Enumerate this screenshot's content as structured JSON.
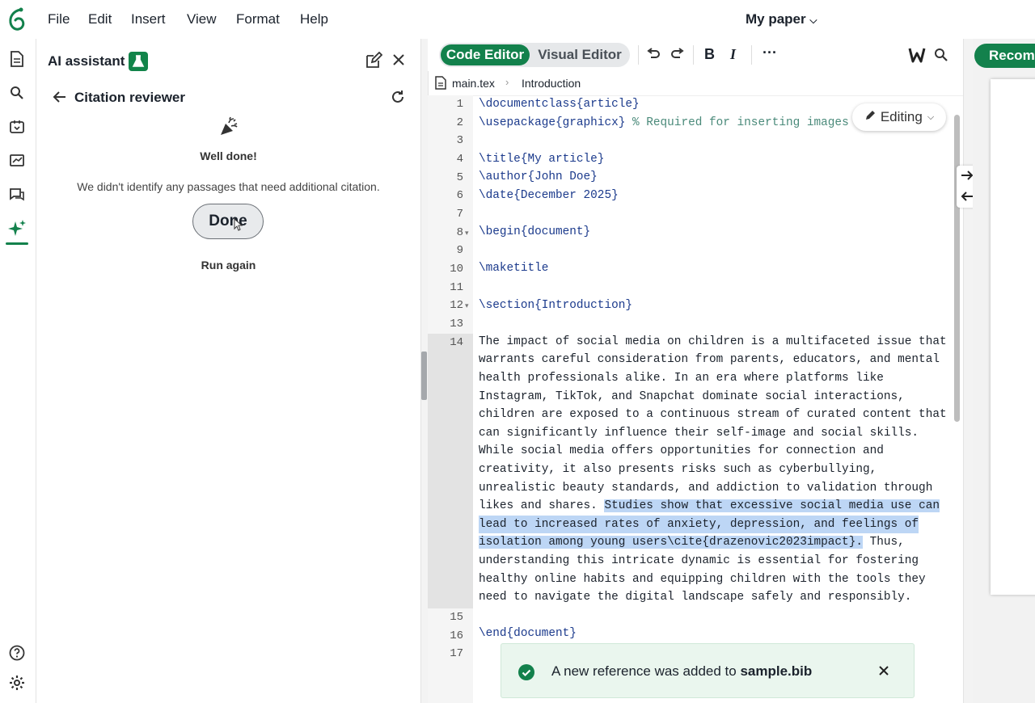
{
  "menu": {
    "items": [
      "File",
      "Edit",
      "Insert",
      "View",
      "Format",
      "Help"
    ],
    "project_title": "My paper"
  },
  "ai_panel": {
    "title": "AI assistant",
    "subpanel_title": "Citation reviewer",
    "well_done": "Well done!",
    "message": "We didn't identify any passages that need additional citation.",
    "done_label": "Done",
    "run_again_label": "Run again"
  },
  "editor": {
    "code_editor_label": "Code Editor",
    "visual_editor_label": "Visual Editor",
    "file_name": "main.tex",
    "section_crumb": "Introduction",
    "editing_label": "Editing",
    "recompile_label": "Recomp",
    "lines": {
      "l1": "\\documentclass{article}",
      "l2a": "\\usepackage{graphicx}",
      "l2b": " % Required for inserting images",
      "l4": "\\title{My article}",
      "l5": "\\author{John Doe}",
      "l6": "\\date{December 2025}",
      "l8": "\\begin{document}",
      "l10": "\\maketitle",
      "l12": "\\section{Introduction}",
      "l16": "\\end{document}",
      "p1": "The impact of social media on children is a multifaceted issue that",
      "p2": "warrants careful consideration from parents, educators, and mental",
      "p3": "health professionals alike. In an era where platforms like",
      "p4": "Instagram, TikTok, and Snapchat dominate social interactions,",
      "p5": "children are exposed to a continuous stream of curated content that",
      "p6": "can significantly influence their self-image and social skills.",
      "p7": "While social media offers opportunities for connection and",
      "p8": "creativity, it also presents risks such as cyberbullying,",
      "p9": "unrealistic beauty standards, and addiction to validation through",
      "p10a": "likes and shares. ",
      "p10b": "Studies show that excessive social media use can",
      "p11": "lead to increased rates of anxiety, depression, and feelings of",
      "p12a": "isolation among young users\\cite{drazenovic2023impact}.",
      "p12b": " Thus,",
      "p13": "understanding this intricate dynamic is essential for fostering",
      "p14": "healthy online habits and equipping children with the tools they",
      "p15": "need to navigate the digital landscape safely and responsibly."
    },
    "line_numbers": [
      "1",
      "2",
      "3",
      "4",
      "5",
      "6",
      "7",
      "8",
      "9",
      "10",
      "11",
      "12",
      "13",
      "14",
      "15",
      "16",
      "17"
    ]
  },
  "toast": {
    "message_prefix": "A new reference was added to ",
    "file": "sample.bib"
  },
  "colors": {
    "brand_green": "#13814c",
    "selection": "#bdd6f5",
    "warning_underline": "#f2c500"
  }
}
